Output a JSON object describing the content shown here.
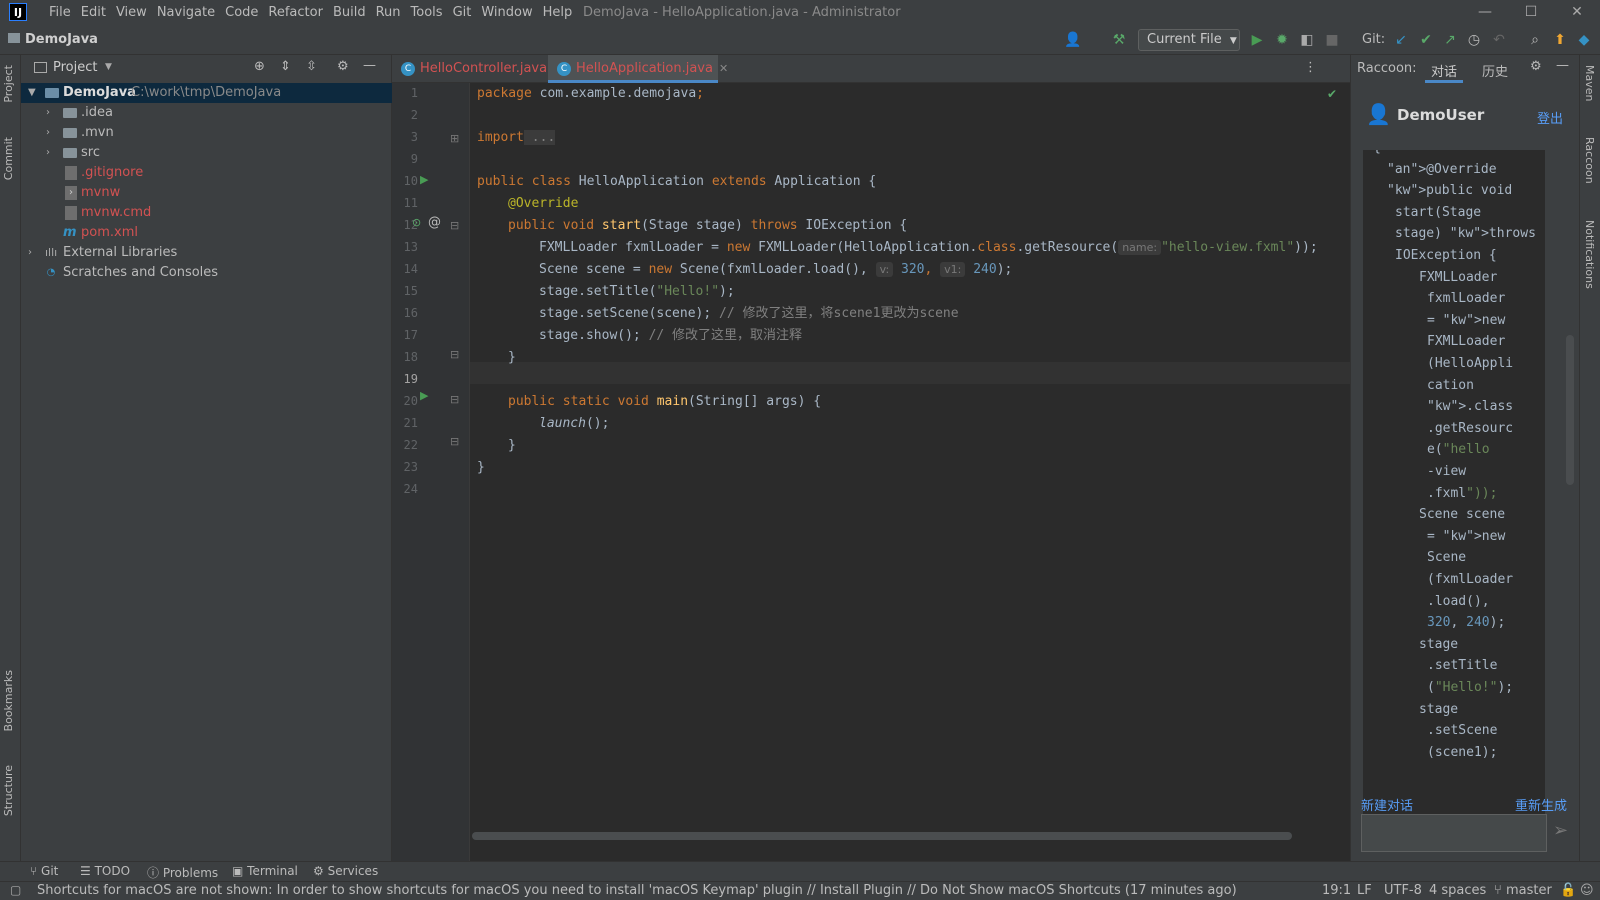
{
  "window": {
    "logo": "IJ",
    "title": "DemoJava - HelloApplication.java - Administrator",
    "menu": [
      "File",
      "Edit",
      "View",
      "Navigate",
      "Code",
      "Refactor",
      "Build",
      "Run",
      "Tools",
      "Git",
      "Window",
      "Help"
    ],
    "minimize": "—",
    "maximize": "☐",
    "close": "✕"
  },
  "navbar": {
    "project": "DemoJava",
    "run_config": "Current File",
    "git_label": "Git:"
  },
  "left_tabs": {
    "project": "Project",
    "commit": "Commit",
    "bookmarks": "Bookmarks",
    "structure": "Structure"
  },
  "project_panel": {
    "title": "Project",
    "tree": [
      {
        "label": "DemoJava",
        "path": "C:\\work\\tmp\\DemoJava"
      },
      {
        "label": ".idea"
      },
      {
        "label": ".mvn"
      },
      {
        "label": "src"
      },
      {
        "label": ".gitignore"
      },
      {
        "label": "mvnw"
      },
      {
        "label": "mvnw.cmd"
      },
      {
        "label": "pom.xml"
      },
      {
        "label": "External Libraries"
      },
      {
        "label": "Scratches and Consoles"
      }
    ]
  },
  "editor": {
    "tabs": [
      "HelloController.java",
      "HelloApplication.java"
    ],
    "line_numbers": [
      "1",
      "2",
      "3",
      "9",
      "10",
      "11",
      "12",
      "13",
      "14",
      "15",
      "16",
      "17",
      "18",
      "19",
      "20",
      "21",
      "22",
      "23",
      "24"
    ],
    "code": {
      "l1_kw": "package",
      "l1_rest": " com.example.demojava",
      "l1_semi": ";",
      "l3_kw": "import",
      "l3_fold": " ...",
      "l10_kw1": "public class",
      "l10_name": " HelloApplication ",
      "l10_kw2": "extends",
      "l10_rest": " Application {",
      "l11_ann": "@Override",
      "l12_kw1": "public void",
      "l12_fn": " start",
      "l12_args": "(Stage stage) ",
      "l12_kw2": "throws",
      "l12_rest": " IOException {",
      "l13_a": "FXMLLoader fxmlLoader = ",
      "l13_new": "new",
      "l13_b": " FXMLLoader(HelloApplication.",
      "l13_class": "class",
      "l13_c": ".getResource(",
      "l13_hint": "name:",
      "l13_str": "\"hello-view.fxml\"",
      "l13_d": "));",
      "l14_a": "Scene scene = ",
      "l14_new": "new",
      "l14_b": " Scene(fxmlLoader.load(), ",
      "l14_hint1": "v:",
      "l14_n1": "320",
      "l14_c": ", ",
      "l14_hint2": "v1:",
      "l14_n2": "240",
      "l14_d": ");",
      "l15_a": "stage.setTitle(",
      "l15_str": "\"Hello!\"",
      "l15_b": ");",
      "l16_a": "stage.setScene(scene); ",
      "l16_cm": "// 修改了这里，将scene1更改为scene",
      "l17_a": "stage.show(); ",
      "l17_cm": "// 修改了这里，取消注释",
      "l18": "}",
      "l20_kw": "public static void",
      "l20_fn": " main",
      "l20_rest": "(String[] args) {",
      "l21_fn": "launch",
      "l21_rest": "();",
      "l22": "}",
      "l23": "}"
    }
  },
  "raccoon": {
    "label": "Raccoon:",
    "tab_chat": "对话",
    "tab_history": "历史",
    "user": "DemoUser",
    "logout": "登出",
    "new_chat": "新建对话",
    "regenerate": "重新生成",
    "chat_lines": [
      "{",
      "@Override",
      "public void",
      "start(Stage",
      "stage) throws",
      "IOException {",
      "FXMLLoader",
      "fxmlLoader",
      "= new",
      "FXMLLoader",
      "(HelloAppli",
      "cation",
      ".class",
      ".getResourc",
      "e(\"hello",
      "-view",
      ".fxml\"));",
      "Scene scene",
      "= new",
      "Scene",
      "(fxmlLoader",
      ".load(),",
      "320, 240);",
      "stage",
      ".setTitle",
      "(\"Hello!\");",
      "stage",
      ".setScene",
      "(scene1);"
    ]
  },
  "right_tabs": {
    "maven": "Maven",
    "raccoon": "Raccoon",
    "notifications": "Notifications"
  },
  "tool_windows": [
    "Git",
    "TODO",
    "Problems",
    "Terminal",
    "Services"
  ],
  "status": {
    "message": "Shortcuts for macOS are not shown: In order to show shortcuts for macOS you need to install 'macOS Keymap' plugin // Install Plugin // Do Not Show macOS Shortcuts (17 minutes ago)",
    "position": "19:1",
    "line_sep": "LF",
    "encoding": "UTF-8",
    "indent": "4 spaces",
    "branch": "master"
  }
}
